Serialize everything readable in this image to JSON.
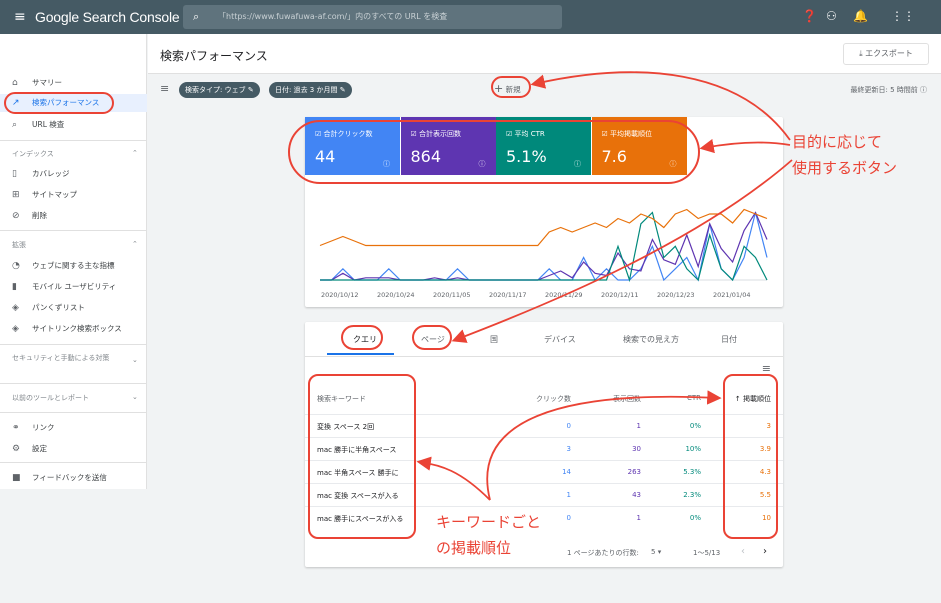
{
  "app": {
    "title": "Google Search Console",
    "search_placeholder": "「https://www.fuwafuwa-af.com/」内のすべての URL を検査"
  },
  "header": {
    "page_title": "検索パフォーマンス",
    "export_label": "エクスポート"
  },
  "filters": {
    "search_type": "検索タイプ: ウェブ",
    "date": "日付: 過去 3 か月間",
    "new_label": "新規",
    "last_updated": "最終更新日: 5 時間前"
  },
  "sidebar": {
    "top": [
      {
        "label": "サマリー"
      },
      {
        "label": "検索パフォーマンス"
      },
      {
        "label": "URL 検査"
      }
    ],
    "index_title": "インデックス",
    "index_items": [
      {
        "label": "カバレッジ"
      },
      {
        "label": "サイトマップ"
      },
      {
        "label": "削除"
      }
    ],
    "ext_title": "拡張",
    "ext_items": [
      {
        "label": "ウェブに関する主な指標"
      },
      {
        "label": "モバイル ユーザビリティ"
      },
      {
        "label": "パンくずリスト"
      },
      {
        "label": "サイトリンク検索ボックス"
      }
    ],
    "security_title": "セキュリティと手動による対策",
    "legacy_title": "以前のツールとレポート",
    "bottom": [
      {
        "label": "リンク"
      },
      {
        "label": "設定"
      },
      {
        "label": "フィードバックを送信"
      }
    ]
  },
  "metrics": [
    {
      "label": "合計クリック数",
      "value": "44",
      "color": "#4285f4"
    },
    {
      "label": "合計表示回数",
      "value": "864",
      "color": "#5e35b1"
    },
    {
      "label": "平均 CTR",
      "value": "5.1%",
      "color": "#00897b"
    },
    {
      "label": "平均掲載順位",
      "value": "7.6",
      "color": "#e8710a"
    }
  ],
  "chart_data": {
    "type": "line",
    "categories": [
      "2020/10/12",
      "2020/10/24",
      "2020/11/05",
      "2020/11/17",
      "2020/11/29",
      "2020/12/11",
      "2020/12/23",
      "2021/01/04"
    ],
    "series": [
      {
        "name": "合計クリック数",
        "values": [
          0,
          0,
          1,
          0,
          0,
          0,
          1,
          0,
          0,
          0,
          0,
          0,
          1,
          0,
          0,
          0,
          0,
          0,
          0,
          0,
          1,
          0,
          0,
          2,
          0,
          1,
          0,
          0,
          1,
          3,
          0,
          1,
          2,
          0,
          5,
          1,
          0,
          2,
          6,
          2
        ]
      },
      {
        "name": "合計表示回数",
        "values": [
          0,
          0,
          3,
          0,
          1,
          1,
          1,
          0,
          0,
          0,
          1,
          0,
          1,
          0,
          0,
          0,
          0,
          0,
          0,
          0,
          2,
          4,
          1,
          8,
          3,
          2,
          12,
          5,
          4,
          18,
          9,
          7,
          20,
          6,
          25,
          14,
          8,
          22,
          30,
          18
        ]
      },
      {
        "name": "平均 CTR",
        "values": [
          0,
          0,
          0,
          0,
          0,
          0,
          0,
          0,
          0,
          0,
          0,
          0,
          0,
          0,
          0,
          0,
          0,
          0,
          0,
          0,
          0,
          0,
          0,
          0,
          0,
          0,
          3,
          0,
          5,
          6,
          2,
          3,
          1,
          0,
          4,
          1,
          0,
          3,
          2,
          0
        ]
      },
      {
        "name": "平均掲載順位",
        "values": [
          10,
          9,
          8,
          9,
          10,
          10,
          10,
          10,
          10,
          10,
          10,
          10,
          10,
          10,
          10,
          10,
          10,
          10,
          10,
          10,
          7,
          6,
          7,
          6,
          5,
          6,
          4,
          5,
          3,
          4,
          6,
          3,
          2,
          4,
          3,
          3,
          5,
          2,
          3,
          4
        ]
      }
    ]
  },
  "tabs": [
    {
      "label": "クエリ"
    },
    {
      "label": "ページ"
    },
    {
      "label": "国"
    },
    {
      "label": "デバイス"
    },
    {
      "label": "検索での見え方"
    },
    {
      "label": "日付"
    }
  ],
  "table": {
    "headers": {
      "keyword": "検索キーワード",
      "clicks": "クリック数",
      "impressions": "表示回数",
      "ctr": "CTR",
      "position": "掲載順位"
    },
    "rows": [
      {
        "keyword": "変換 スペース 2回",
        "clicks": "0",
        "impressions": "1",
        "ctr": "0%",
        "position": "3"
      },
      {
        "keyword": "mac 勝手に半角スペース",
        "clicks": "3",
        "impressions": "30",
        "ctr": "10%",
        "position": "3.9"
      },
      {
        "keyword": "mac 半角スペース 勝手に",
        "clicks": "14",
        "impressions": "263",
        "ctr": "5.3%",
        "position": "4.3"
      },
      {
        "keyword": "mac 変換 スペースが入る",
        "clicks": "1",
        "impressions": "43",
        "ctr": "2.3%",
        "position": "5.5"
      },
      {
        "keyword": "mac 勝手にスペースが入る",
        "clicks": "0",
        "impressions": "1",
        "ctr": "0%",
        "position": "10"
      }
    ]
  },
  "pagination": {
    "rows_label": "1 ページあたりの行数:",
    "rows_value": "5",
    "range": "1〜5/13"
  },
  "annotations": {
    "buttons_line1": "目的に応じて",
    "buttons_line2": "使用するボタン",
    "kw_line1": "キーワードごと",
    "kw_line2": "の掲載順位"
  }
}
